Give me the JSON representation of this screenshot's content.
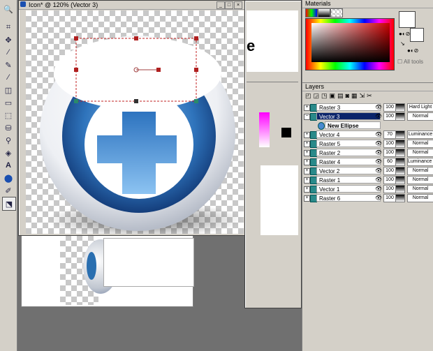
{
  "doc_window": {
    "title": "Icon* @ 120% (Vector 3)",
    "buttons": [
      "_",
      "□",
      "×"
    ]
  },
  "materials": {
    "title": "Materials",
    "all_tools_label": "All tools"
  },
  "layers": {
    "title": "Layers",
    "rows": [
      {
        "name": "Raster 3",
        "opacity": "100",
        "blend": "Hard Light",
        "selected": false,
        "sub": false
      },
      {
        "name": "Vector 3",
        "opacity": "100",
        "blend": "Normal",
        "selected": true,
        "sub": false
      },
      {
        "name": "New Ellipse",
        "opacity": "",
        "blend": "",
        "selected": false,
        "sub": true
      },
      {
        "name": "Vector 4",
        "opacity": "70",
        "blend": "Luminance",
        "selected": false,
        "sub": false
      },
      {
        "name": "Raster 5",
        "opacity": "100",
        "blend": "Normal",
        "selected": false,
        "sub": false
      },
      {
        "name": "Raster 2",
        "opacity": "100",
        "blend": "Normal",
        "selected": false,
        "sub": false
      },
      {
        "name": "Raster 4",
        "opacity": "60",
        "blend": "Luminance (L)",
        "selected": false,
        "sub": false
      },
      {
        "name": "Vector 2",
        "opacity": "100",
        "blend": "Normal",
        "selected": false,
        "sub": false
      },
      {
        "name": "Raster 1",
        "opacity": "100",
        "blend": "Normal",
        "selected": false,
        "sub": false
      },
      {
        "name": "Vector 1",
        "opacity": "100",
        "blend": "Normal",
        "selected": false,
        "sub": false
      },
      {
        "name": "Raster 6",
        "opacity": "100",
        "blend": "Normal",
        "selected": false,
        "sub": false
      }
    ]
  },
  "bg_window": {
    "partial_text": "e"
  },
  "tools": [
    "zoom-icon",
    "crop-icon",
    "move-icon",
    "dropper-icon",
    "pen-icon",
    "brush-icon",
    "clone-icon",
    "eraser-icon",
    "selection-icon",
    "bucket-icon",
    "picture-tube-icon",
    "fill-icon",
    "text-icon",
    "shape-icon",
    "freehand-icon",
    "vector-select-icon"
  ]
}
